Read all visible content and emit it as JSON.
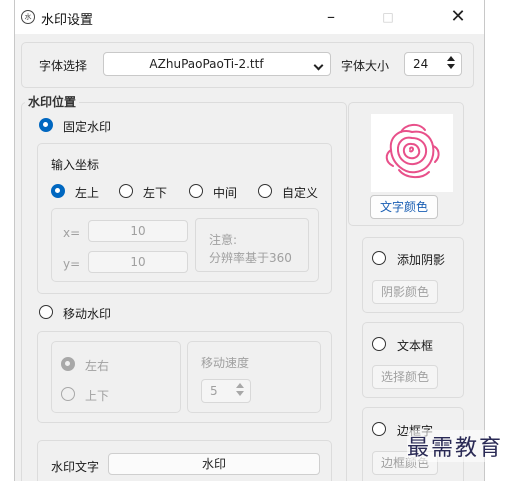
{
  "window": {
    "title": "水印设置",
    "icon": "watermark-app-icon",
    "controls": {
      "minimize": "–",
      "maximize": "□",
      "close": "✕"
    }
  },
  "font": {
    "select_label": "字体选择",
    "selected_font": "AZhuPaoPaoTi-2.ttf",
    "size_label": "字体大小",
    "size_value": "24"
  },
  "position": {
    "group_title": "水印位置",
    "fixed_label": "固定水印",
    "coords_title": "输入坐标",
    "anchors": [
      "左上",
      "左下",
      "中间",
      "自定义"
    ],
    "selected_anchor": "左上",
    "x_label": "x=",
    "x_value": "10",
    "y_label": "y=",
    "y_value": "10",
    "note_title": "注意:",
    "note_text": "分辨率基于360",
    "moving_label": "移动水印",
    "directions": [
      "左右",
      "上下"
    ],
    "speed_label": "移动速度",
    "speed_value": "5"
  },
  "text": {
    "label": "水印文字",
    "value": "水印"
  },
  "style": {
    "text_color_button": "文字颜色",
    "shadow_label": "添加阴影",
    "shadow_color_button": "阴影颜色",
    "textbox_label": "文本框",
    "textbox_color_button": "选择颜色",
    "border_label": "边框字",
    "border_color_button": "边框颜色"
  },
  "colors": {
    "accent": "#0067c0",
    "rose": "#e8508a",
    "link_text": "#1a5fb4"
  },
  "overlay": {
    "watermark_text": "最需教育"
  }
}
